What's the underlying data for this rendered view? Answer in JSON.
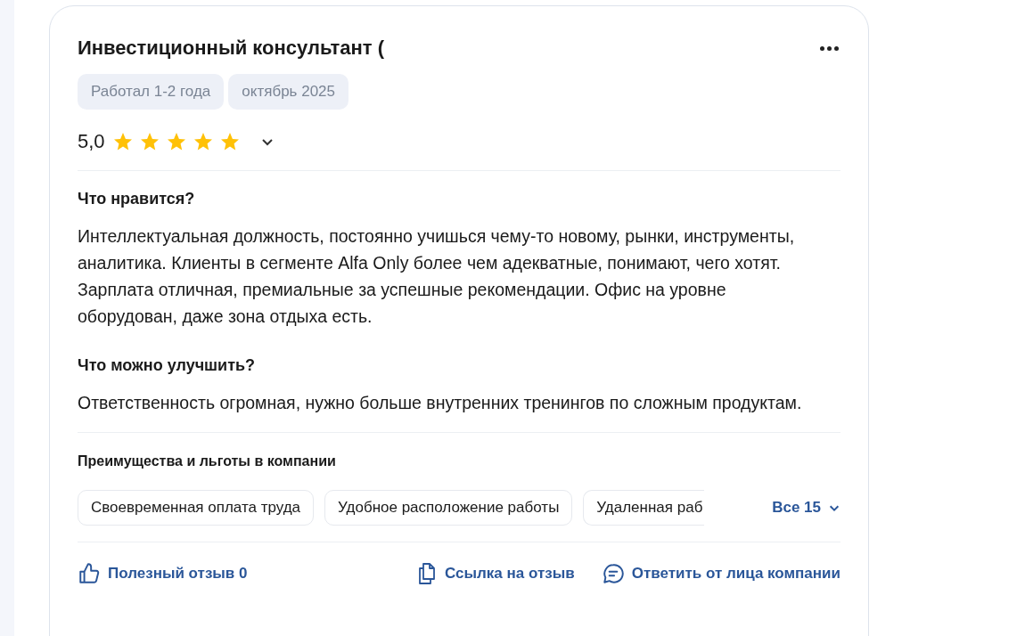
{
  "review": {
    "title": "Инвестиционный консультант (",
    "tags": [
      "Работал 1-2 года",
      "октябрь 2025"
    ],
    "rating": "5,0",
    "stars": 5,
    "sections": [
      {
        "heading": "Что нравится?",
        "text": "Интеллектуальная должность, постоянно учишься чему-то новому, рынки, инструменты, аналитика. Клиенты в сегменте Alfa Only более чем адекватные, понимают, чего хотят. Зарплата отличная, премиальные за успешные рекомендации. Офис на уровне оборудован, даже зона отдыха есть."
      },
      {
        "heading": "Что можно улучшить?",
        "text": "Ответственность огромная, нужно больше внутренних тренингов по сложным продуктам."
      }
    ],
    "benefits_title": "Преимущества и льготы в компании",
    "benefits": [
      "Своевременная оплата труда",
      "Удобное расположение работы",
      "Удаленная раб"
    ],
    "benefits_more": "Все 15",
    "actions": [
      {
        "kind": "like",
        "label": "Полезный отзыв 0"
      },
      {
        "kind": "link",
        "label": "Ссылка на отзыв"
      },
      {
        "kind": "reply",
        "label": "Ответить от лица компании"
      }
    ]
  }
}
